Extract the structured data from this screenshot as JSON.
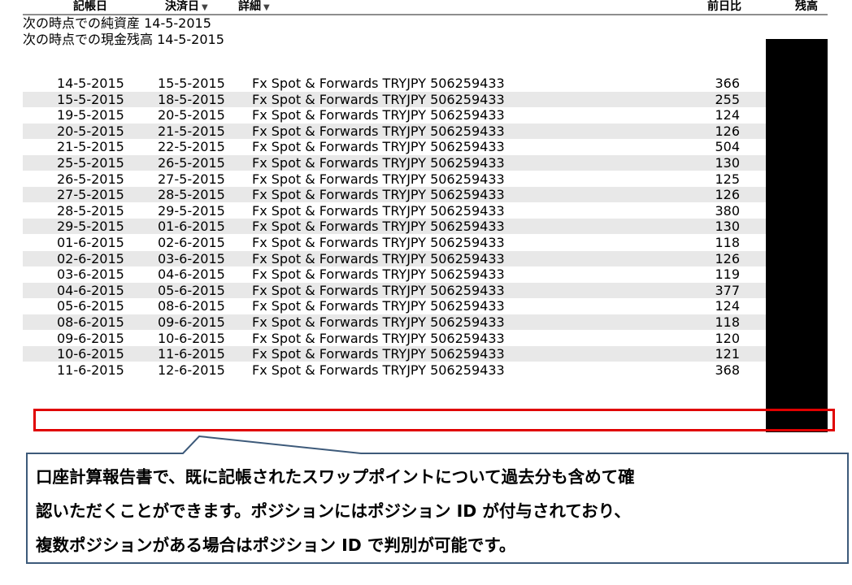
{
  "table": {
    "headers": {
      "record_date": "記帳日",
      "settle_date": "決済日",
      "detail": "詳細",
      "change": "前日比",
      "balance": "残高"
    },
    "summary": [
      "次の時点での純資産 14-5-2015",
      "次の時点での現金残高 14-5-2015"
    ],
    "rows": [
      {
        "date": "14-5-2015",
        "settle": "15-5-2015",
        "desc": "Fx Spot & Forwards TRYJPY 506259433",
        "amount": "366"
      },
      {
        "date": "15-5-2015",
        "settle": "18-5-2015",
        "desc": "Fx Spot & Forwards TRYJPY 506259433",
        "amount": "255"
      },
      {
        "date": "19-5-2015",
        "settle": "20-5-2015",
        "desc": "Fx Spot & Forwards TRYJPY 506259433",
        "amount": "124"
      },
      {
        "date": "20-5-2015",
        "settle": "21-5-2015",
        "desc": "Fx Spot & Forwards TRYJPY 506259433",
        "amount": "126"
      },
      {
        "date": "21-5-2015",
        "settle": "22-5-2015",
        "desc": "Fx Spot & Forwards TRYJPY 506259433",
        "amount": "504"
      },
      {
        "date": "25-5-2015",
        "settle": "26-5-2015",
        "desc": "Fx Spot & Forwards TRYJPY 506259433",
        "amount": "130"
      },
      {
        "date": "26-5-2015",
        "settle": "27-5-2015",
        "desc": "Fx Spot & Forwards TRYJPY 506259433",
        "amount": "125"
      },
      {
        "date": "27-5-2015",
        "settle": "28-5-2015",
        "desc": "Fx Spot & Forwards TRYJPY 506259433",
        "amount": "126"
      },
      {
        "date": "28-5-2015",
        "settle": "29-5-2015",
        "desc": "Fx Spot & Forwards TRYJPY 506259433",
        "amount": "380"
      },
      {
        "date": "29-5-2015",
        "settle": "01-6-2015",
        "desc": "Fx Spot & Forwards TRYJPY 506259433",
        "amount": "130"
      },
      {
        "date": "01-6-2015",
        "settle": "02-6-2015",
        "desc": "Fx Spot & Forwards TRYJPY 506259433",
        "amount": "118"
      },
      {
        "date": "02-6-2015",
        "settle": "03-6-2015",
        "desc": "Fx Spot & Forwards TRYJPY 506259433",
        "amount": "126"
      },
      {
        "date": "03-6-2015",
        "settle": "04-6-2015",
        "desc": "Fx Spot & Forwards TRYJPY 506259433",
        "amount": "119"
      },
      {
        "date": "04-6-2015",
        "settle": "05-6-2015",
        "desc": "Fx Spot & Forwards TRYJPY 506259433",
        "amount": "377"
      },
      {
        "date": "05-6-2015",
        "settle": "08-6-2015",
        "desc": "Fx Spot & Forwards TRYJPY 506259433",
        "amount": "124"
      },
      {
        "date": "08-6-2015",
        "settle": "09-6-2015",
        "desc": "Fx Spot & Forwards TRYJPY 506259433",
        "amount": "118"
      },
      {
        "date": "09-6-2015",
        "settle": "10-6-2015",
        "desc": "Fx Spot & Forwards TRYJPY 506259433",
        "amount": "120"
      },
      {
        "date": "10-6-2015",
        "settle": "11-6-2015",
        "desc": "Fx Spot & Forwards TRYJPY 506259433",
        "amount": "121"
      },
      {
        "date": "11-6-2015",
        "settle": "12-6-2015",
        "desc": "Fx Spot & Forwards TRYJPY 506259433",
        "amount": "368"
      }
    ]
  },
  "callout": {
    "lines": [
      "口座計算報告書で、既に記帳されたスワップポイントについて過去分も含めて確",
      "認いただくことができます。ポジションにはポジション ID が付与されており、",
      "複数ポジションがある場合はポジション ID で判別が可能です。"
    ]
  },
  "colors": {
    "highlight_border": "#e00000",
    "callout_border": "#3d5a7a",
    "stripe": "#e8e8e8",
    "redaction": "#000000"
  }
}
